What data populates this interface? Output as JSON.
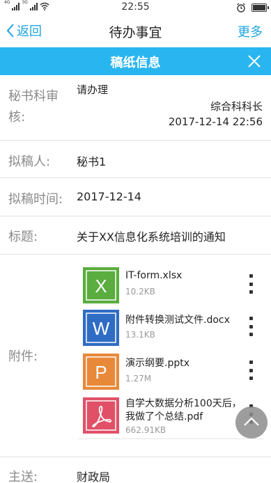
{
  "status_bar": {
    "signal1_label": "4G",
    "signal2_label": "3G",
    "time": "22:55"
  },
  "nav": {
    "back_label": "返回",
    "title": "待办事宜",
    "more_label": "更多"
  },
  "header": {
    "title": "稿纸信息",
    "accent_color": "#29b6f0"
  },
  "fields": {
    "review": {
      "label_line1": "秘书科审",
      "label_line2": "核:",
      "opinion": "请办理",
      "department": "综合科科长",
      "time": "2017-12-14 22:56"
    },
    "drafter": {
      "label": "拟稿人:",
      "value": "秘书1"
    },
    "draft_time": {
      "label": "拟稿时间:",
      "value": "2017-12-14"
    },
    "subject": {
      "label": "标题:",
      "value": "关于XX信息化系统培训的通知"
    },
    "attachments_label": "附件:",
    "recipient": {
      "label": "主送:",
      "value": "财政局"
    }
  },
  "attachments": [
    {
      "name": "IT-form.xlsx",
      "size": "10.2KB",
      "icon": "excel-icon",
      "letter": "X",
      "color": "#5aad3e"
    },
    {
      "name": "附件转换测试文件.docx",
      "size": "13.1KB",
      "icon": "word-icon",
      "letter": "W",
      "color": "#2f6cc4"
    },
    {
      "name": "演示纲要.pptx",
      "size": "1.27M",
      "icon": "powerpoint-icon",
      "letter": "P",
      "color": "#e8893a"
    },
    {
      "name": "自学大数据分析100天后，我做了个总结.pdf",
      "size": "662.91KB",
      "icon": "pdf-icon",
      "letter": "",
      "color": "#e05168"
    }
  ]
}
